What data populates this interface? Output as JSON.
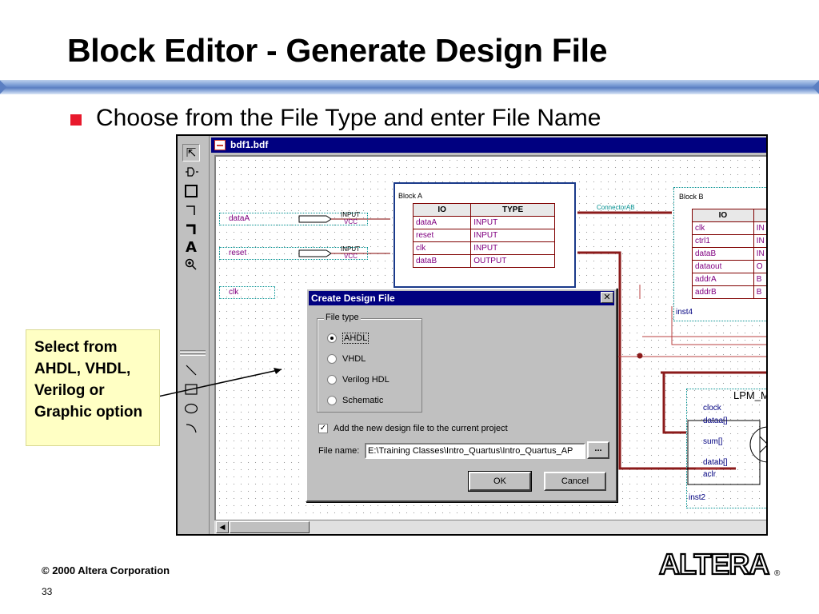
{
  "slide": {
    "title": "Block Editor - Generate Design File",
    "bullet": "Choose from the File Type and enter File Name",
    "callout": "Select from AHDL, VHDL, Verilog or Graphic option",
    "copyright": "© 2000 Altera Corporation",
    "page_number": "33",
    "logo_text": "ALTERA",
    "accent_color": "#e8192c"
  },
  "editor": {
    "window_title": "bdf1.bdf",
    "toolbar_icons": [
      "pointer-icon",
      "symbol-icon",
      "block-icon",
      "orthogonal-node-icon",
      "orthogonal-bus-icon",
      "text-icon",
      "zoom-icon",
      "line-icon",
      "rectangle-icon",
      "ellipse-icon",
      "arc-icon"
    ],
    "pins": [
      {
        "name": "dataA",
        "type": "INPUT",
        "default": "VCC"
      },
      {
        "name": "reset",
        "type": "INPUT",
        "default": "VCC"
      },
      {
        "name": "clk"
      }
    ],
    "block_a": {
      "label": "Block A",
      "headers": [
        "IO",
        "TYPE"
      ],
      "rows": [
        [
          "dataA",
          "INPUT"
        ],
        [
          "reset",
          "INPUT"
        ],
        [
          "clk",
          "INPUT"
        ],
        [
          "dataB",
          "OUTPUT"
        ]
      ]
    },
    "connector": "ConnectorAB",
    "block_b": {
      "label": "Block B",
      "header": "IO",
      "rows": [
        [
          "clk",
          "IN"
        ],
        [
          "ctrl1",
          "IN"
        ],
        [
          "dataB",
          "IN"
        ],
        [
          "dataout",
          "O"
        ],
        [
          "addrA",
          "B"
        ],
        [
          "addrB",
          "B"
        ]
      ],
      "instance": "inst4"
    },
    "lpm": {
      "label": "LPM_M",
      "ports": [
        "clock",
        "dataa[]",
        "sum[]",
        "datab[]",
        "aclr"
      ],
      "instance": "inst2"
    }
  },
  "dialog": {
    "title": "Create Design File",
    "close_glyph": "✕",
    "group_label": "File type",
    "options": [
      "AHDL",
      "VHDL",
      "Verilog HDL",
      "Schematic"
    ],
    "selected": "AHDL",
    "add_to_project_label": "Add the new design file to the current project",
    "add_to_project_checked": true,
    "file_name_label": "File name:",
    "file_name_value": "E:\\Training Classes\\Intro_Quartus\\Intro_Quartus_AP",
    "browse_label": "...",
    "ok_label": "OK",
    "cancel_label": "Cancel"
  }
}
